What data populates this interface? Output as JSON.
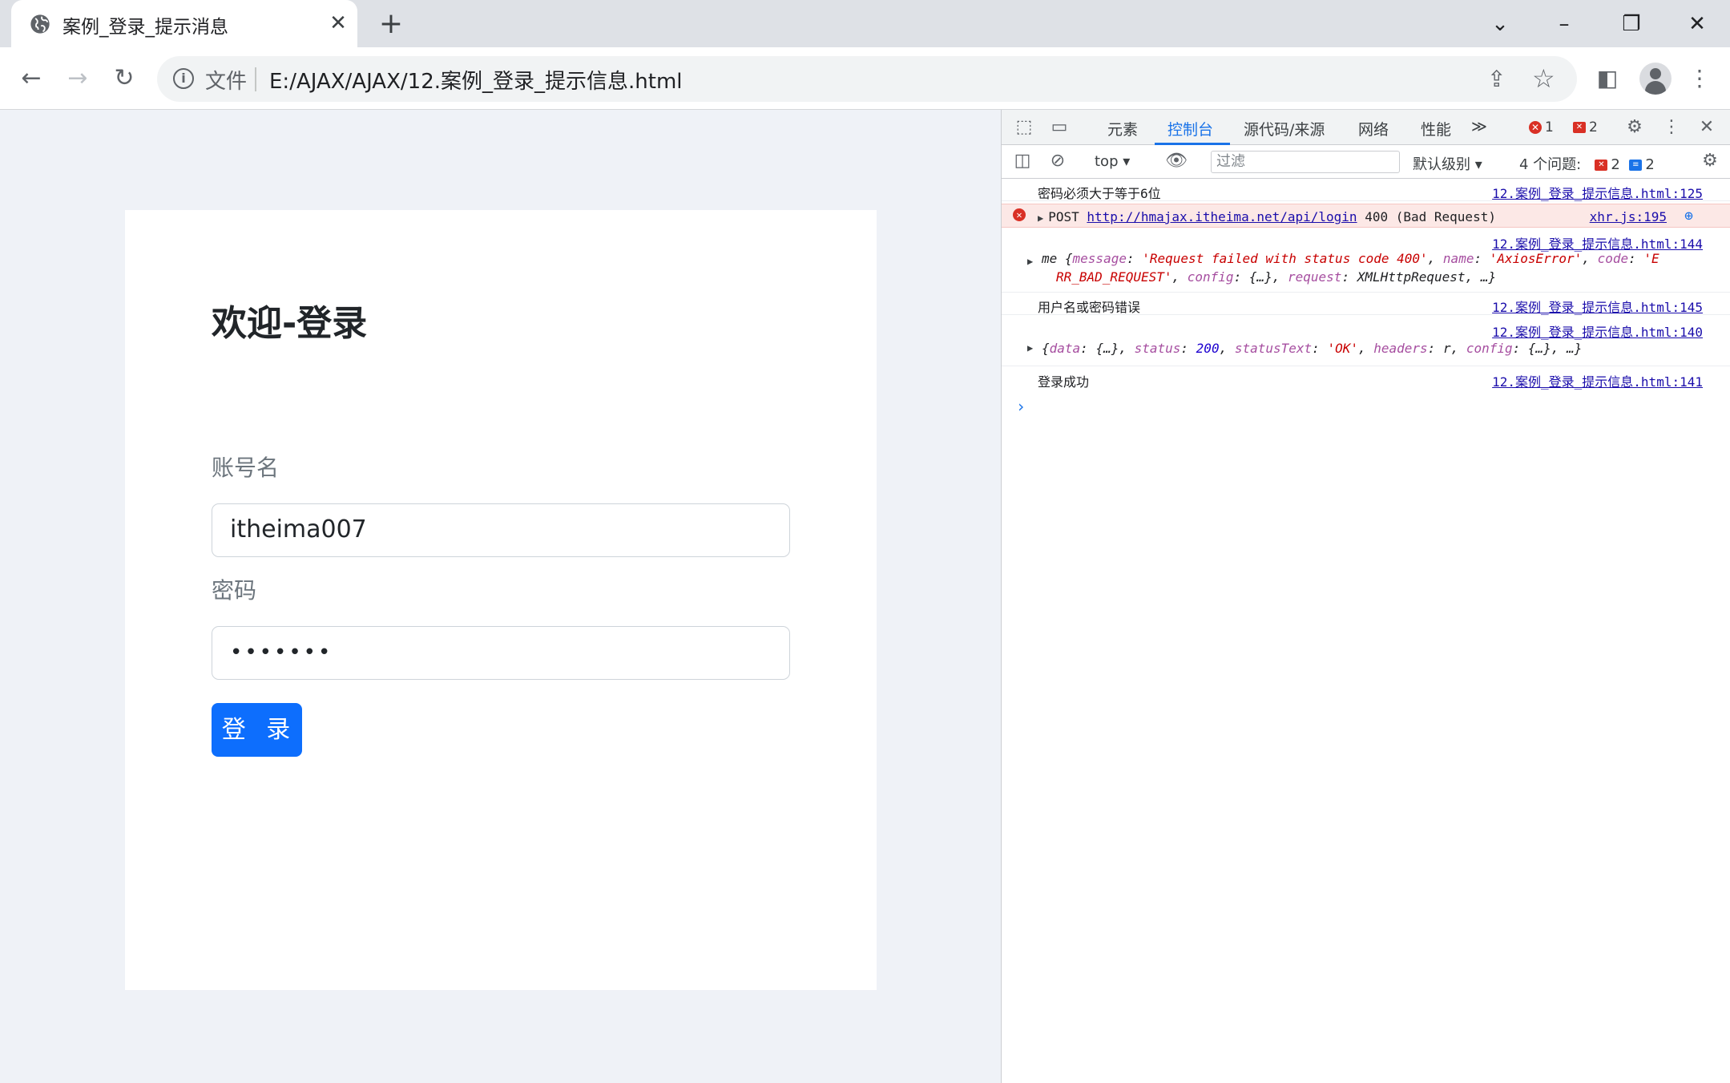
{
  "browser": {
    "tab_title": "案例_登录_提示消息",
    "tab_close": "✕",
    "new_tab": "+",
    "address_scheme": "文件",
    "address_url": "E:/AJAX/AJAX/12.案例_登录_提示信息.html"
  },
  "page": {
    "heading": "欢迎-登录",
    "username_label": "账号名",
    "username_value": "itheima007",
    "password_label": "密码",
    "password_value": "•••••••",
    "login_button": "登 录"
  },
  "devtools": {
    "tabs": [
      "元素",
      "控制台",
      "源代码/来源",
      "网络",
      "性能"
    ],
    "more": "≫",
    "error_count": "1",
    "warning_count": "2",
    "context": "top",
    "filter_placeholder": "过滤",
    "level": "默认级别",
    "issues_label": "4 个问题:",
    "issues_error": "2",
    "issues_info": "2",
    "console": [
      {
        "msg": "密码必须大于等于6位",
        "src": "12.案例_登录_提示信息.html:125"
      },
      {
        "msg_prefix": "POST",
        "url": "http://hmajax.itheima.net/api/login",
        "status": "400 (Bad Request)",
        "src": "xhr.js:195"
      },
      {
        "src": "12.案例_登录_提示信息.html:144",
        "name": "me",
        "message_key": "message",
        "message_val": "'Request failed with status code 400'",
        "name_key": "name",
        "name_val": "'AxiosError'",
        "code_key": "code",
        "code_val_1": "'E",
        "code_val_2": "RR_BAD_REQUEST'",
        "config_key": "config",
        "config_val": "{…}",
        "request_key": "request",
        "request_val": "XMLHttpRequest",
        "ellipsis": "…}"
      },
      {
        "msg": "用户名或密码错误",
        "src": "12.案例_登录_提示信息.html:145"
      },
      {
        "src": "12.案例_登录_提示信息.html:140",
        "data_key": "data",
        "data_val": "{…}",
        "status_key": "status",
        "status_val": "200",
        "statusText_key": "statusText",
        "statusText_val": "'OK'",
        "headers_key": "headers",
        "headers_val": "r",
        "config_key": "config",
        "config_val": "{…}",
        "ellipsis": "…}"
      },
      {
        "msg": "登录成功",
        "src": "12.案例_登录_提示信息.html:141"
      }
    ],
    "prompt": "›"
  }
}
